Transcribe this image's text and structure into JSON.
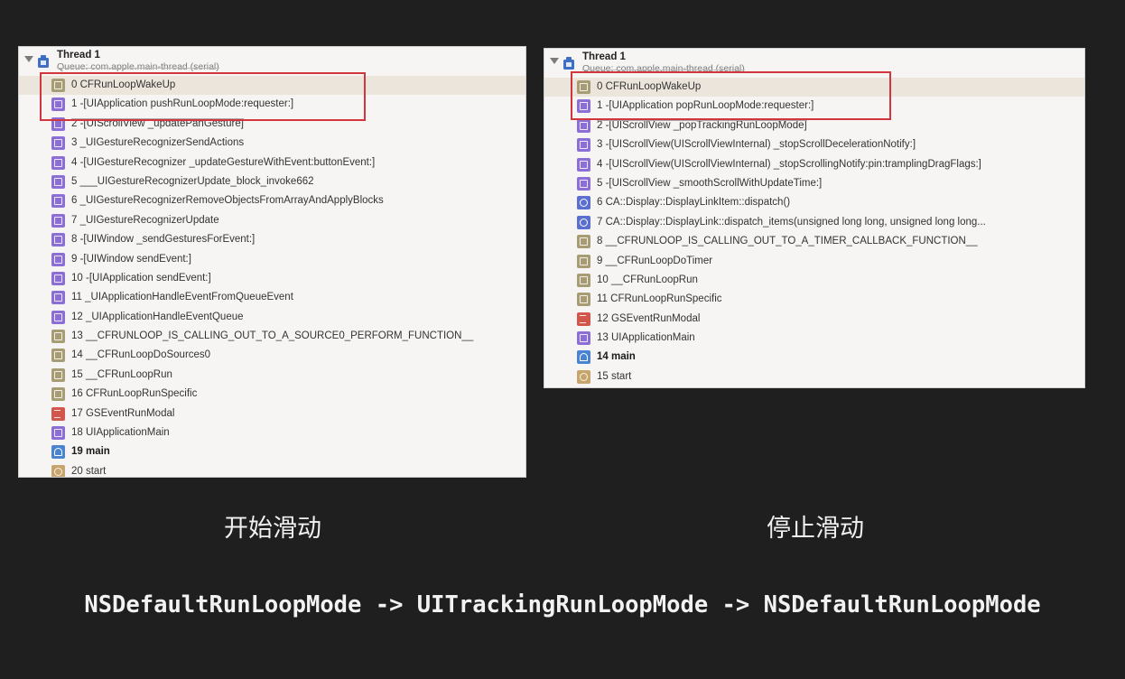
{
  "left_panel": {
    "thread_title": "Thread 1",
    "queue": "Queue: com.apple.main-thread (serial)",
    "frames": [
      {
        "text": "0 CFRunLoopWakeUp",
        "icon": "olive-frame-icon",
        "selected": true
      },
      {
        "text": "1 -[UIApplication pushRunLoopMode:requester:]",
        "icon": "purple-frame-icon"
      },
      {
        "text": "2 -[UIScrollView _updatePanGesture]",
        "icon": "purple-frame-icon",
        "struck": true
      },
      {
        "text": "3 _UIGestureRecognizerSendActions",
        "icon": "purple-frame-icon"
      },
      {
        "text": "4 -[UIGestureRecognizer _updateGestureWithEvent:buttonEvent:]",
        "icon": "purple-frame-icon"
      },
      {
        "text": "5 ___UIGestureRecognizerUpdate_block_invoke662",
        "icon": "purple-frame-icon"
      },
      {
        "text": "6 _UIGestureRecognizerRemoveObjectsFromArrayAndApplyBlocks",
        "icon": "purple-frame-icon"
      },
      {
        "text": "7 _UIGestureRecognizerUpdate",
        "icon": "purple-frame-icon"
      },
      {
        "text": "8 -[UIWindow _sendGesturesForEvent:]",
        "icon": "purple-frame-icon"
      },
      {
        "text": "9 -[UIWindow sendEvent:]",
        "icon": "purple-frame-icon"
      },
      {
        "text": "10 -[UIApplication sendEvent:]",
        "icon": "purple-frame-icon"
      },
      {
        "text": "11 _UIApplicationHandleEventFromQueueEvent",
        "icon": "purple-frame-icon"
      },
      {
        "text": "12 _UIApplicationHandleEventQueue",
        "icon": "purple-frame-icon"
      },
      {
        "text": "13 __CFRUNLOOP_IS_CALLING_OUT_TO_A_SOURCE0_PERFORM_FUNCTION__",
        "icon": "olive-frame-icon"
      },
      {
        "text": "14 __CFRunLoopDoSources0",
        "icon": "olive-frame-icon"
      },
      {
        "text": "15 __CFRunLoopRun",
        "icon": "olive-frame-icon"
      },
      {
        "text": "16 CFRunLoopRunSpecific",
        "icon": "olive-frame-icon"
      },
      {
        "text": "17 GSEventRunModal",
        "icon": "red-frame-icon"
      },
      {
        "text": "18 UIApplicationMain",
        "icon": "purple-frame-icon"
      },
      {
        "text": "19 main",
        "icon": "user-frame-icon",
        "bold": true
      },
      {
        "text": "20 start",
        "icon": "gear-frame-icon"
      }
    ]
  },
  "right_panel": {
    "thread_title": "Thread 1",
    "queue": "Queue: com.apple.main-thread (serial)",
    "frames": [
      {
        "text": "0 CFRunLoopWakeUp",
        "icon": "olive-frame-icon",
        "selected": true
      },
      {
        "text": "1 -[UIApplication popRunLoopMode:requester:]",
        "icon": "purple-frame-icon"
      },
      {
        "text": "2 -[UIScrollView _popTrackingRunLoopMode]",
        "icon": "purple-frame-icon",
        "struck": true
      },
      {
        "text": "3 -[UIScrollView(UIScrollViewInternal) _stopScrollDecelerationNotify:]",
        "icon": "purple-frame-icon"
      },
      {
        "text": "4 -[UIScrollView(UIScrollViewInternal) _stopScrollingNotify:pin:tramplingDragFlags:]",
        "icon": "purple-frame-icon"
      },
      {
        "text": "5 -[UIScrollView _smoothScrollWithUpdateTime:]",
        "icon": "purple-frame-icon"
      },
      {
        "text": "6 CA::Display::DisplayLinkItem::dispatch()",
        "icon": "display-frame-icon"
      },
      {
        "text": "7 CA::Display::DisplayLink::dispatch_items(unsigned long long, unsigned long long...",
        "icon": "display-frame-icon"
      },
      {
        "text": "8 __CFRUNLOOP_IS_CALLING_OUT_TO_A_TIMER_CALLBACK_FUNCTION__",
        "icon": "olive-frame-icon"
      },
      {
        "text": "9 __CFRunLoopDoTimer",
        "icon": "olive-frame-icon"
      },
      {
        "text": "10 __CFRunLoopRun",
        "icon": "olive-frame-icon"
      },
      {
        "text": "11 CFRunLoopRunSpecific",
        "icon": "olive-frame-icon"
      },
      {
        "text": "12 GSEventRunModal",
        "icon": "red-frame-icon"
      },
      {
        "text": "13 UIApplicationMain",
        "icon": "purple-frame-icon"
      },
      {
        "text": "14 main",
        "icon": "user-frame-icon",
        "bold": true
      },
      {
        "text": "15 start",
        "icon": "gear-frame-icon"
      }
    ]
  },
  "captions": {
    "left": "开始滑动",
    "right": "停止滑动"
  },
  "transition_text": "NSDefaultRunLoopMode -> UITrackingRunLoopMode -> NSDefaultRunLoopMode",
  "colors": {
    "background": "#1f1f1f",
    "highlight": "#d2363d"
  }
}
